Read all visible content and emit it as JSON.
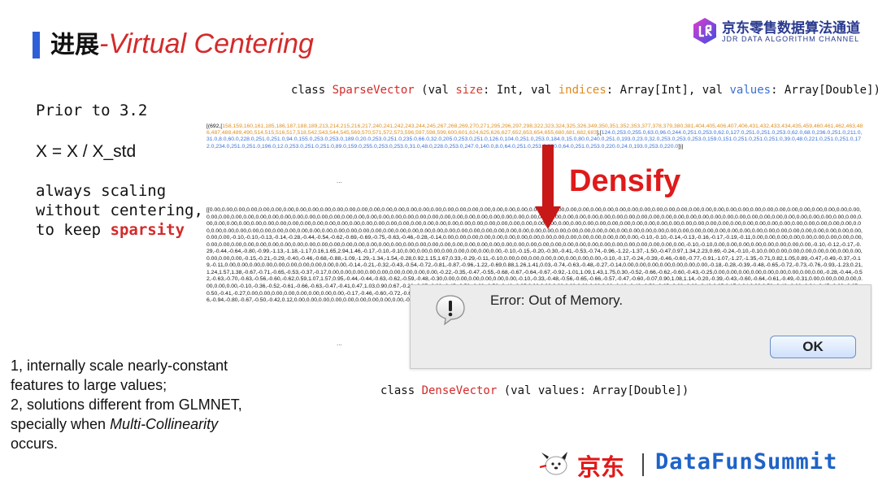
{
  "title": {
    "cn": "进展",
    "sep": "-",
    "en": "Virtual Centering"
  },
  "logo": {
    "cn": "京东零售数据算法通道",
    "en": "JDR DATA ALGORITHM CHANNEL",
    "icon": "jdr-logo-icon"
  },
  "left": {
    "prior": "Prior to 3.2",
    "formula": "X = X / X_std",
    "line1": "always scaling",
    "line2": "without centering,",
    "line3_prefix": "to keep ",
    "line3_highlight": "sparsity"
  },
  "notes": {
    "n1a": "1, internally scale nearly-constant",
    "n1b": "features to large values;",
    "n2a": "2, solutions different from GLMNET,",
    "n2b_prefix": "specially when ",
    "n2b_italic": "Multi-Collinearity",
    "n2c": "occurs."
  },
  "sparse_decl": {
    "prefix": "class ",
    "name": "SparseVector",
    "open": " (val ",
    "kw_size": "size",
    "type_size": ": Int, val ",
    "kw_indices": "indices",
    "type_indices": ": Array[Int], val ",
    "kw_values": "values",
    "type_values": ": Array[Double])"
  },
  "dense_decl": {
    "prefix": "class ",
    "name": "DenseVector",
    "rest": " (val values: Array[Double])"
  },
  "sparse_data": {
    "head": "[(692,[",
    "indices": "158,159,160,161,185,186,187,188,189,213,214,215,216,217,240,241,242,243,244,245,267,268,269,270,271,295,296,297,298,322,323,324,325,326,349,350,351,352,353,377,378,379,380,381,404,405,406,407,406,431,432,433,434,435,459,460,461,462,463,486,487,488,489,490,514,515,516,517,518,542,543,544,545,569,570,571,572,573,596,597,598,599,600,601,624,625,626,627,652,653,654,655,680,681,682,683",
    "mid": "],[",
    "values": "124.0,253.0,255.0,63.0,96.0,244.0,251.0,253.0,62.0,127.0,251.0,251.0,253.0,62.0,68.0,236.0,251.0,211.0,31.0,8.0,60.0,228.0,251.0,251.0,94.0,155.0,253.0,253.0,189.0,20.0,253.0,251.0,235.0,66.0,32.0,205.0,253.0,251.0,126.0,104.0,251.0,253.0,184.0,15.0,80.0,240.0,251.0,193.0,23.0,32.0,253.0,253.0,253.0,159.0,151.0,251.0,251.0,251.0,39.0,48.0,221.0,251.0,251.0,172.0,234.0,251.0,251.0,196.0,12.0,253.0,251.0,251.0,89.0,159.0,255.0,253.0,253.0,31.0,48.0,228.0,253.0,247.0,140.0,8.0,64.0,251.0,253.0,220.0,64.0,251.0,253.0,220.0,24.0,193.0,253.0,220.0",
    "tail": "])]"
  },
  "dense_data": "[[0.00,0.00,0.00,0.00,0.00,0.00,0.00,0.00,0.00,0.00,0.00,0.00,0.00,0.00,0.00,0.00,0.00,0.00,0.00,0.00,0.00,0.00,0.00,0.00,0.00,0.00,0.00,0.00,0.00,0.00,0.00,0.00,0.00,0.00,0.00,0.00,0.00,0.00,0.00,0.00,0.00,0.00,0.00,0.00,0.00,0.00,0.00,0.00,0.00,0.00,0.00,0.00,0.00,0.00,0.00,0.00,0.00,0.00,0.00,0.00,0.00,0.00,0.00,0.00,0.00,0.00,0.00,0.00,0.00,0.00,0.00,0.00,0.00,0.00,0.00,0.00,0.00,0.00,0.00,0.00,0.00,0.00,0.00,0.00,0.00,0.00,0.00,0.00,0.00,0.00,0.00,0.00,0.00,0.00,0.00,0.00,0.00,0.00,0.00,0.00,0.00,0.00,0.00,0.00,0.00,0.00,0.00,0.00,0.00,0.00,0.00,0.00,0.00,0.00,0.00,0.00,0.00,0.00,0.00,0.00,0.00,0.00,0.00,0.00,0.00,0.00,0.00,0.00,0.00,0.00,0.00,0.00,0.00,0.00,0.00,0.00,0.00,0.00,0.00,0.00,0.00,0.00,0.00,0.00,0.00,0.00,0.00,0.00,0.00,0.00,0.00,0.00,0.00,0.00,0.00,0.00,0.00,0.00,0.00,0.00,0.00,0.00,0.00,0.00,0.00,0.00,0.00,0.00,0.00,0.00,0.00,0.00,0.00,0.00,0.00,0.00,0.00,0.00,0.00,0.00,0.00,0.00,0.00,0.00,0.00,0.00,0.00,0.00,0.00,0.00,0.00,0.00,0.00,0.00,0.00,0.00,0.00,0.00,0.00,0.00,0.00,0.00,0.00,0.00,0.00,0.00,0.00,0.00,0.00,0.00,0.00,0.00,0.00,0.00,0.00,-0.10,-0.10,-0.13,-0.14,-0.28,-0.44,-0.54,-0.62,-0.69,-0.69,-0.75,-0.63,-0.46,-0.28,-0.14,0.00,0.00,0.00,0.00,0.00,0.00,0.00,0.00,0.00,0.00,0.00,0.00,0.00,0.00,0.00,0.00,-0.10,-0.10,-0.14,-0.13,-0.16,-0.17,-0.19,-0.11,0.00,0.00,0.00,0.00,0.00,0.00,0.00,0.00,0.00,0.00,0.00,0.00,0.00,0.00,0.00,0.00,0.00,0.00,0.00,0.00,0.00,0.00,0.00,0.00,0.00,0.00,0.00,0.00,0.00,0.00,0.00,0.00,0.00,0.00,0.00,0.00,0.00,0.00,0.00,0.00,0.00,0.00,0.00,0.00,0.00,0.00,0.00,0.00,-0.10,-0.10,0.00,0.00,0.00,0.00,0.00,0.00,0.00,0.00,-0.10,-0.12,-0.17,-0.29,-0.44,-0.64,-0.80,-0.99,-1.13,-1.18,-1.17,0.16,1.65,2.94,1.46,-0.17,-0.10,-0.10,0.00,0.00,0.00,0.00,0.00,0.00,0.00,0.00,-0.10,-0.15,-0.20,-0.30,-0.41,-0.53,-0.74,-0.96,-1.22,-1.37,-1.50,-0.47,0.97,1.34,2.23,0.69,-0.24,-0.10,-0.10,0.00,0.00,0.00,0.00,0.00,0.00,0.00,0.00,0.00,0.00,0.00,-0.15,-0.21,-0.29,-0.40,-0.46,-0.68,-0.88,-1.09,-1.29,-1.34,-1.54,-0.28,0.92,1.15,1.67,0.33,-0.29,-0.11,-0.10,0.00,0.00,0.00,0.00,0.00,0.00,0.00,0.00,-0.10,-0.17,-0.24,-0.39,-0.46,-0.60,-0.77,-0.91,-1.07,-1.27,-1.35,-0.71,0.82,1.05,0.89,-0.47,-0.49,-0.37,-0.19,-0.11,0.00,0.00,0.00,0.00,0.00,0.00,0.00,0.00,0.00,0.00,-0.14,-0.21,-0.32,-0.43,-0.54,-0.72,-0.81,-0.87,-0.96,-1.22,-0.69,0.88,1.26,1.41,0.03,-0.74,-0.63,-0.48,-0.27,-0.14,0.00,0.00,0.00,0.00,0.00,0.00,0.00,-0.18,-0.28,-0.39,-0.48,-0.65,-0.72,-0.73,-0.76,-0.93,-1.23,0.21,1.24,1.57,1.38,-0.67,-0.71,-0.65,-0.53,-0.37,-0.17,0.00,0.00,0.00,0.00,0.00,0.00,0.00,0.00,0.00,-0.22,-0.35,-0.47,-0.55,-0.68,-0.67,-0.64,-0.67,-0.92,-1.01,1.09,1.43,1.75,0.30,-0.52,-0.66,-0.62,-0.60,-0.43,-0.25,0.00,0.00,0.00,0.00,0.00,0.00,0.00,0.00,0.00,-0.28,-0.44,-0.52,-0.63,-0.70,-0.63,-0.56,-0.60,-0.62,0.59,1.07,1.57,0.95,-0.44,-0.44,-0.63,-0.62,-0.59,-0.48,-0.30,0.00,0.00,0.00,0.00,0.00,0.00,-0.10,-0.33,-0.48,-0.56,-0.65,-0.66,-0.57,-0.47,-0.60,-0.07,0.90,1.08,1.14,-0.20,-0.39,-0.43,-0.60,-0.64,-0.61,-0.49,-0.31,0.00,0.00,0.00,0.00,0.00,0.00,0.00,-0.10,-0.36,-0.52,-0.61,-0.66,-0.63,-0.47,-0.41,0.47,1.03,0.90,0.67,-0.28,-0.37,-0.33,-0.45,-0.59,-0.63,-0.56,-0.48,-0.35,0.00,0.00,0.00,0.00,0.00,0.00,0.00,-0.12,-0.42,-0.56,-0.65,-0.69,-0.62,-0.43,0.25,2.17,1.04,0.92,0.58,-0.43,-0.28,-0.34,-0.47,-0.62,-0.65,-0.50,-0.41,-0.27,0.00,0.00,0.00,0.00,0.00,0.00,0.00,0.00,-0.17,-0.46,-0.60,-0.72,-0.61,2.21,1.77,1.41,0.65,-0.79,-0.63,-0.47,-0.55,-0.61,-0.70,-0.63,-0.35,-0.26,-0.18,0.00,0.00,0.00,0.00,0.00,0.00,0.00,0.00,-0.13,-0.32,-0.48,-0.63,0.41,0.83,0.92,0.82,-0.11,-1.27,-1.22,-1.06,-0.94,-0.80,-0.67,-0.50,-0.42,0.12,0.00,0.00,0.00,0.00,0.00,0.00,0.00,0.00,0.00,-0.10,-0.16,-0.30,0.14,0.51,2.88,3.18,2.56,-0.38,-0.35,-0.40,-0.35,-0.22,-0.18,-0.16,-0.13]]",
  "ellipsis1": "...",
  "ellipsis2": "...",
  "densify": "Densify",
  "dialog": {
    "message": "Error: Out of Memory.",
    "ok_label": "OK",
    "icon": "warning-icon"
  },
  "footer": {
    "jd": "京东",
    "brand": "DataFunSummit",
    "mascot_icon": "jd-dog-mascot-icon"
  },
  "colors": {
    "accent_blue": "#2f5fd6",
    "red": "#d42a2a",
    "arrow_red": "#c81818",
    "orange": "#e09020",
    "blue_values": "#3a72d8",
    "footer_blue": "#1e63c8"
  }
}
